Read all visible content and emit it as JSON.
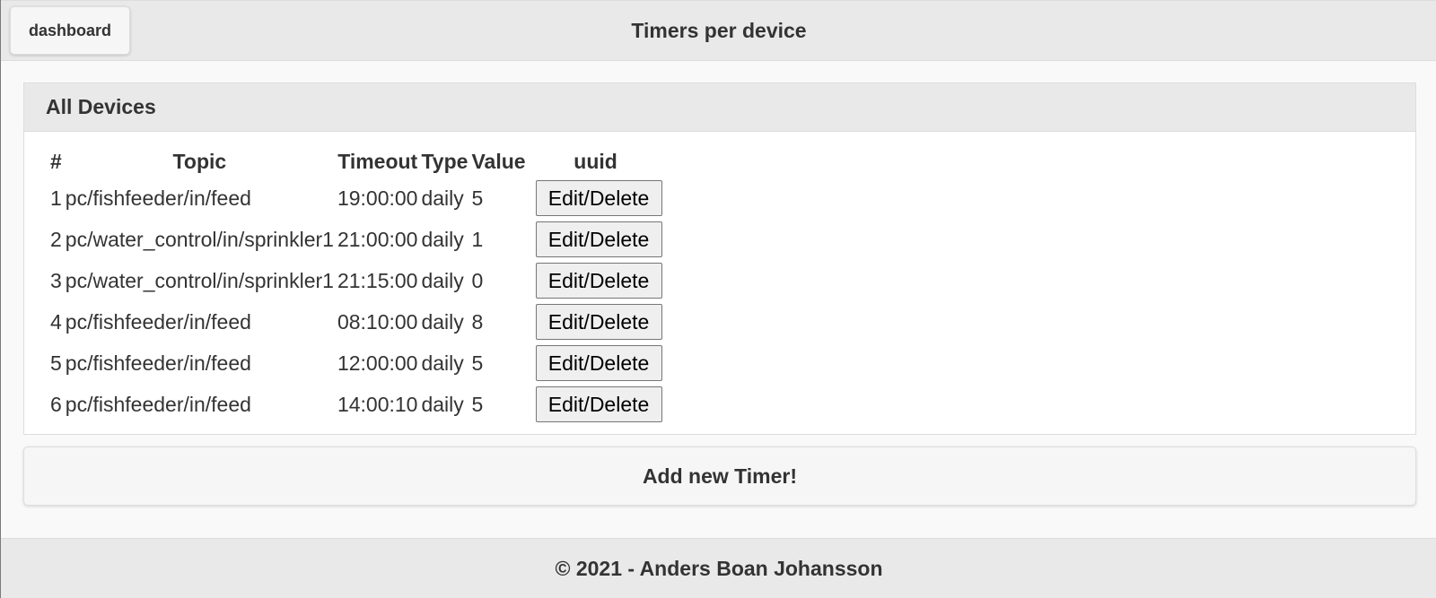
{
  "header": {
    "back_button_label": "dashboard",
    "title": "Timers per device"
  },
  "panel": {
    "title": "All Devices",
    "columns": [
      "#",
      "Topic",
      "Timeout",
      "Type",
      "Value",
      "uuid"
    ],
    "rows": [
      {
        "num": "1",
        "topic": "pc/fishfeeder/in/feed",
        "timeout": "19:00:00",
        "type": "daily",
        "value": "5",
        "action": "Edit/Delete"
      },
      {
        "num": "2",
        "topic": "pc/water_control/in/sprinkler1",
        "timeout": "21:00:00",
        "type": "daily",
        "value": "1",
        "action": "Edit/Delete"
      },
      {
        "num": "3",
        "topic": "pc/water_control/in/sprinkler1",
        "timeout": "21:15:00",
        "type": "daily",
        "value": "0",
        "action": "Edit/Delete"
      },
      {
        "num": "4",
        "topic": "pc/fishfeeder/in/feed",
        "timeout": "08:10:00",
        "type": "daily",
        "value": "8",
        "action": "Edit/Delete"
      },
      {
        "num": "5",
        "topic": "pc/fishfeeder/in/feed",
        "timeout": "12:00:00",
        "type": "daily",
        "value": "5",
        "action": "Edit/Delete"
      },
      {
        "num": "6",
        "topic": "pc/fishfeeder/in/feed",
        "timeout": "14:00:10",
        "type": "daily",
        "value": "5",
        "action": "Edit/Delete"
      }
    ]
  },
  "add_button_label": "Add new Timer!",
  "footer": {
    "text": "© 2021 - Anders Boan Johansson"
  },
  "colors": {
    "bar_background": "#e9e9e9",
    "page_background": "#f9f9f9",
    "text": "#333333"
  }
}
